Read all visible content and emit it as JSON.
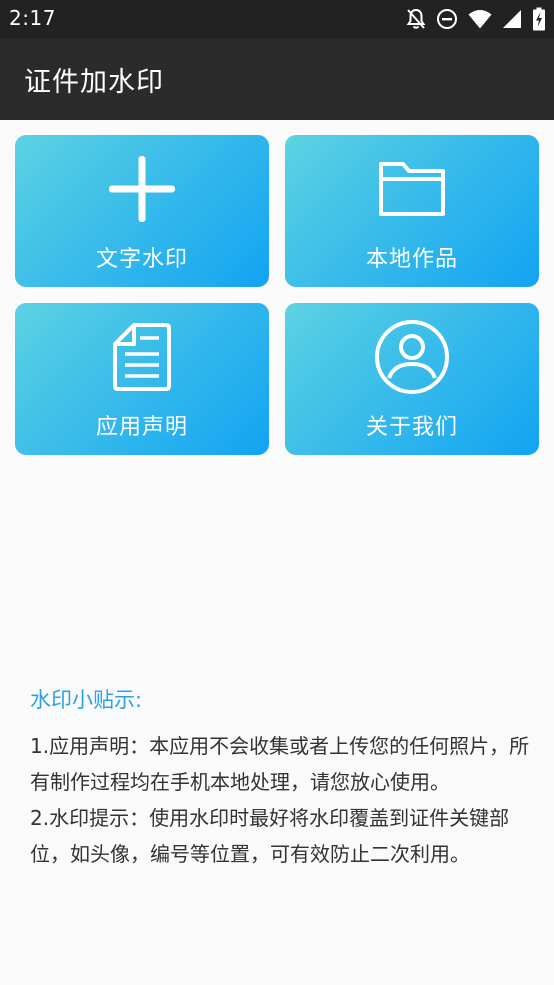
{
  "status_bar": {
    "time": "2:17",
    "icons": [
      "notifications-off-icon",
      "do-not-disturb-icon",
      "wifi-icon",
      "cell-signal-icon",
      "battery-charging-icon"
    ]
  },
  "app_bar": {
    "title": "证件加水印"
  },
  "tiles": [
    {
      "label": "文字水印",
      "icon": "plus-icon"
    },
    {
      "label": "本地作品",
      "icon": "folder-icon"
    },
    {
      "label": "应用声明",
      "icon": "document-icon"
    },
    {
      "label": "关于我们",
      "icon": "account-icon"
    }
  ],
  "tips": {
    "title": "水印小贴示:",
    "lines": [
      "1.应用声明：本应用不会收集或者上传您的任何照片，所有制作过程均在手机本地处理，请您放心使用。",
      "2.水印提示：使用水印时最好将水印覆盖到证件关键部位，如头像，编号等位置，可有效防止二次利用。"
    ]
  },
  "colors": {
    "tile_gradient_start": "#5dd2e2",
    "tile_gradient_end": "#12a3f2",
    "tips_title": "#29a3e4",
    "app_bar": "#2b2b2b",
    "status_bar": "#222222"
  }
}
